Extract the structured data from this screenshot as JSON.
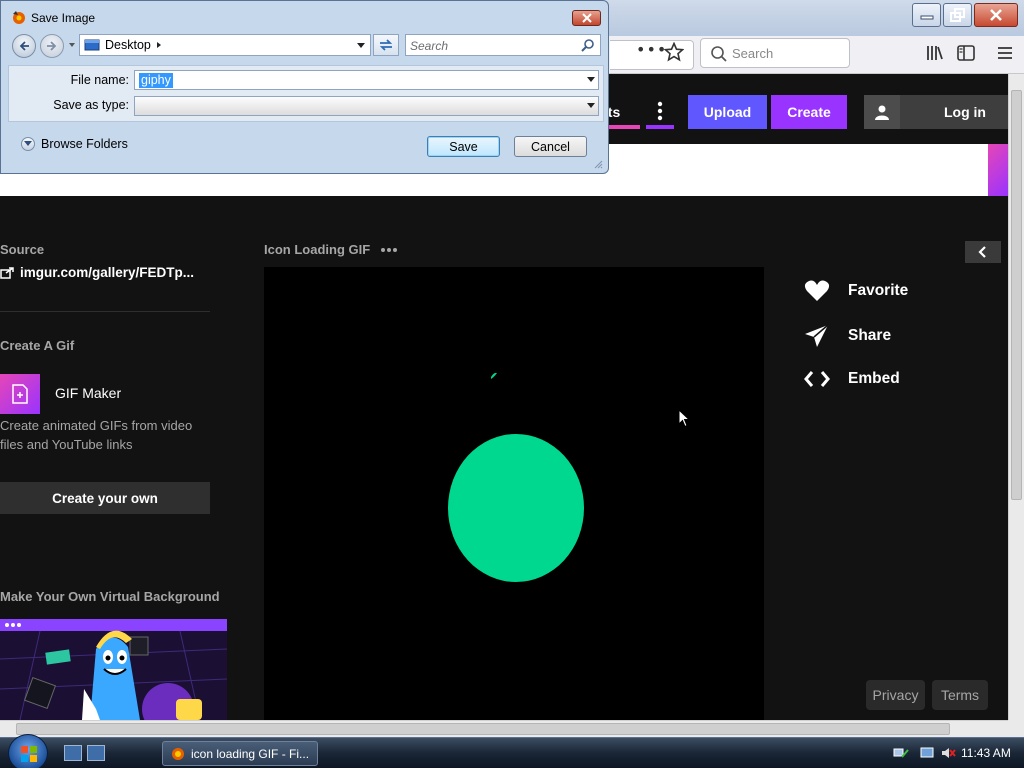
{
  "browser": {
    "search_placeholder": "Search"
  },
  "dialog": {
    "title": "Save Image",
    "location": "Desktop",
    "search_placeholder": "Search",
    "file_name_label": "File name:",
    "file_name_value": "giphy",
    "save_as_type_label": "Save as type:",
    "save_as_type_value": "",
    "browse_folders_label": "Browse Folders",
    "save_label": "Save",
    "cancel_label": "Cancel"
  },
  "nav": {
    "stories_label": "sts",
    "upload_label": "Upload",
    "create_label": "Create",
    "login_label": "Log in"
  },
  "sidebar": {
    "source_label": "Source",
    "source_link": "imgur.com/gallery/FEDTp...",
    "create_gif_heading": "Create A Gif",
    "gif_maker_title": "GIF Maker",
    "gif_maker_desc": "Create animated GIFs from video files and YouTube links",
    "create_own_label": "Create your own",
    "virtual_bg_heading": "Make Your Own Virtual Background"
  },
  "gif": {
    "title": "Icon Loading GIF",
    "blob_color": "#00d890"
  },
  "actions": {
    "favorite": "Favorite",
    "share": "Share",
    "embed": "Embed"
  },
  "footer": {
    "privacy": "Privacy",
    "terms": "Terms"
  },
  "taskbar": {
    "task_label": "icon loading GIF - Fi...",
    "clock": "11:43 AM"
  },
  "colors": {
    "upload": "#6157ff",
    "create": "#9933ff",
    "accent_pink": "#e646b6"
  }
}
